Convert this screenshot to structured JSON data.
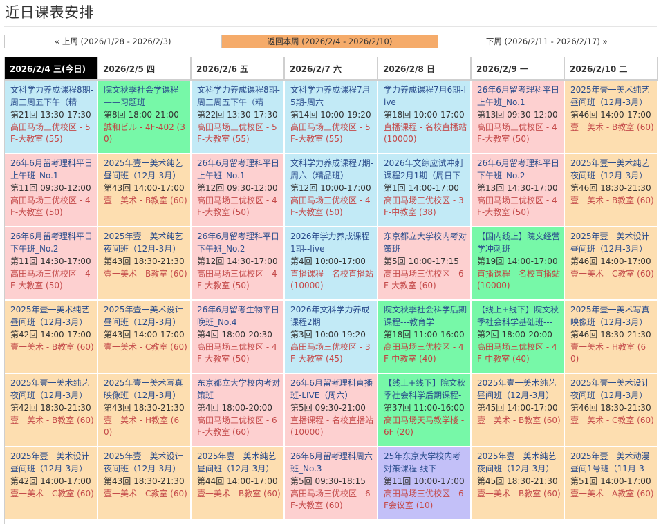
{
  "page": {
    "title": "近日课表安排"
  },
  "week_nav": {
    "prev": "« 上周 (2026/1/28 - 2026/2/3)",
    "current": "返回本周 (2026/2/4 - 2026/2/10)",
    "next": "下周 (2026/2/11 - 2026/2/17) »"
  },
  "colors": {
    "today_header_bg": "#000000",
    "current_week_bg": "#f5ab6a",
    "blue": "#c2eaf6",
    "green": "#77f8a8",
    "pink": "#fdd0d0",
    "peach": "#fddeb0",
    "purple": "#c3c0f8",
    "course_link": "#2a4c8c",
    "venue_text": "#c44a4a"
  },
  "days": [
    {
      "date": "2026/2/4 三(今日)",
      "today": true,
      "classes": [
        {
          "name": "文科学力养成课程8期-周三周五下午（精",
          "session": "第21回 13:30-17:30",
          "venue": "高田马场三优校区 - 5F-大教室 (55)",
          "color": "blue"
        },
        {
          "name": "26年6月留考理科平日上午班_No.1",
          "session": "第11回 09:30-12:00",
          "venue": "高田马场三优校区 - 4F-大教室 (50)",
          "color": "pink"
        },
        {
          "name": "26年6月留考理科平日下午班_No.2",
          "session": "第11回 14:30-17:00",
          "venue": "高田马场三优校区 - 4F-大教室 (50)",
          "color": "pink"
        },
        {
          "name": "2025年壹一美术纯艺昼间班（12月-3月）",
          "session": "第42回 14:00-17:00",
          "venue": "壹一美术 - B教室 (60)",
          "color": "peach"
        },
        {
          "name": "2025年壹一美术纯艺夜间班（12月-3月）",
          "session": "第42回 18:30-21:30",
          "venue": "壹一美术 - B教室 (60)",
          "color": "peach"
        },
        {
          "name": "2025年壹一美术设计昼间班（12月-3月）",
          "session": "第42回 14:00-17:00",
          "venue": "壹一美术 - C教室 (60)",
          "color": "peach"
        }
      ]
    },
    {
      "date": "2026/2/5 四",
      "today": false,
      "classes": [
        {
          "name": "院文秋季社会学课程——习题班",
          "session": "第8回 18:00-21:00",
          "venue": "誠和ビル - 4F-402 (30)",
          "color": "green"
        },
        {
          "name": "2025年壹一美术纯艺昼间班（12月-3月）",
          "session": "第43回 14:00-17:00",
          "venue": "壹一美术 - B教室 (60)",
          "color": "peach"
        },
        {
          "name": "2025年壹一美术纯艺夜间班（12月-3月）",
          "session": "第43回 18:30-21:30",
          "venue": "壹一美术 - B教室 (60)",
          "color": "peach"
        },
        {
          "name": "2025年壹一美术设计昼间班（12月-3月）",
          "session": "第43回 14:00-17:00",
          "venue": "壹一美术 - C教室 (60)",
          "color": "peach"
        },
        {
          "name": "2025年壹一美术写真映像班（12月-3月）",
          "session": "第43回 18:30-21:30",
          "venue": "壹一美术 - H教室 (60)",
          "color": "peach"
        },
        {
          "name": "2025年壹一美术设计夜间班（12月-3月）",
          "session": "第43回 18:30-21:30",
          "venue": "壹一美术 - C教室 (60)",
          "color": "peach"
        }
      ]
    },
    {
      "date": "2026/2/6 五",
      "today": false,
      "classes": [
        {
          "name": "文科学力养成课程8期-周三周五下午（精",
          "session": "第22回 13:30-17:30",
          "venue": "高田马场三优校区 - 5F-大教室 (55)",
          "color": "blue"
        },
        {
          "name": "26年6月留考理科平日上午班_No.1",
          "session": "第12回 09:30-12:00",
          "venue": "高田马场三优校区 - 4F-大教室 (50)",
          "color": "pink"
        },
        {
          "name": "26年6月留考理科平日下午班_No.2",
          "session": "第12回 14:30-17:00",
          "venue": "高田马场三优校区 - 4F-大教室 (50)",
          "color": "pink"
        },
        {
          "name": "26年6月留考生物平日晚班_No.4",
          "session": "第4回 18:00-20:30",
          "venue": "高田马场三优校区 - 4F-大教室 (50)",
          "color": "pink"
        },
        {
          "name": "东京都立大学校内考对策班",
          "session": "第4回 18:00-20:00",
          "venue": "高田马场三优校区 - 6F-大教室 (60)",
          "color": "pink"
        },
        {
          "name": "2025年壹一美术纯艺昼间班（12月-3月）",
          "session": "第44回 14:00-17:00",
          "venue": "壹一美术 - B教室 (60)",
          "color": "peach"
        }
      ]
    },
    {
      "date": "2026/2/7 六",
      "today": false,
      "classes": [
        {
          "name": "文科学力养成课程7月5期-周六",
          "session": "第14回 10:00-19:20",
          "venue": "高田马场三优校区 - 5F-大教室 (55)",
          "color": "blue"
        },
        {
          "name": "文科学力养成课程7期-周六（精品班）",
          "session": "第12回 10:00-17:00",
          "venue": "高田马场三优校区 - 4F-大教室 (50)",
          "color": "blue"
        },
        {
          "name": "2026年学力养成课程1期--live",
          "session": "第4回 10:00-17:00",
          "venue": "直播课程 - 名校直播站 (10000)",
          "color": "blue"
        },
        {
          "name": "2026年文科学力养成课程2期",
          "session": "第3回 10:00-19:20",
          "venue": "高田马场三优校区 - 3F-大教室 (45)",
          "color": "blue"
        },
        {
          "name": "26年6月留考理科直播班-LIVE（周六）",
          "session": "第5回 09:30-21:00",
          "venue": "直播课程 - 名校直播站 (10000)",
          "color": "pink"
        },
        {
          "name": "26年6月留考理科周六班_No.3",
          "session": "第5回 09:30-18:15",
          "venue": "高田马场三优校区 - 6F-大教室 (60)",
          "color": "pink"
        }
      ]
    },
    {
      "date": "2026/2/8 日",
      "today": false,
      "classes": [
        {
          "name": "学力养成课程7月6期-live",
          "session": "第18回 10:00-17:00",
          "venue": "直播课程 - 名校直播站 (10000)",
          "color": "blue"
        },
        {
          "name": "2026年文综应试冲刺课程2月1期（周日下",
          "session": "第1回 14:00-17:00",
          "venue": "高田马场三优校区 - 3F-中教室 (38)",
          "color": "blue"
        },
        {
          "name": "东京都立大学校内考对策班",
          "session": "第5回 10:00-17:15",
          "venue": "高田马场三优校区 - 6F-大教室 (60)",
          "color": "pink"
        },
        {
          "name": "院文秋季社会科学后期课程---教育学",
          "session": "第18回 11:00-16:00",
          "venue": "高田马场三优校区 - 4F-中教室 (40)",
          "color": "green"
        },
        {
          "name": "【线上+线下】院文秋季社会科学后期课程-",
          "session": "第37回 11:00-16:00",
          "venue": "高田马场天马教学楼 - 6F (20)",
          "color": "green"
        },
        {
          "name": "25年东京大学校内考对策课程-线下",
          "session": "第11回 10:00-17:00",
          "venue": "高田马场三优校区 - 6F会议室 (10)",
          "color": "purple"
        }
      ]
    },
    {
      "date": "2026/2/9 一",
      "today": false,
      "classes": [
        {
          "name": "26年6月留考理科平日上午班_No.1",
          "session": "第13回 09:30-12:00",
          "venue": "高田马场三优校区 - 4F-大教室 (50)",
          "color": "pink"
        },
        {
          "name": "26年6月留考理科平日下午班_No.2",
          "session": "第13回 14:30-17:00",
          "venue": "高田马场三优校区 - 4F-大教室 (50)",
          "color": "pink"
        },
        {
          "name": "【国内线上】院文经营学冲刺班",
          "session": "第19回 14:00-17:00",
          "venue": "直播课程 - 名校直播站 (10000)",
          "color": "green"
        },
        {
          "name": "【线上+线下】院文秋季社会科学基础班---",
          "session": "第2回 18:00-20:00",
          "venue": "高田马场三优校区 - 4F-中教室 (40)",
          "color": "green"
        },
        {
          "name": "2025年壹一美术纯艺昼间班（12月-3月）",
          "session": "第45回 14:00-17:00",
          "venue": "壹一美术 - B教室 (60)",
          "color": "peach"
        },
        {
          "name": "2025年壹一美术纯艺夜间班（12月-3月）",
          "session": "第45回 18:30-21:30",
          "venue": "壹一美术 - B教室 (60)",
          "color": "peach"
        }
      ]
    },
    {
      "date": "2026/2/10 二",
      "today": false,
      "classes": [
        {
          "name": "2025年壹一美术纯艺昼间班（12月-3月）",
          "session": "第46回 14:00-17:00",
          "venue": "壹一美术 - B教室 (60)",
          "color": "peach"
        },
        {
          "name": "2025年壹一美术纯艺夜间班（12月-3月）",
          "session": "第46回 18:30-21:30",
          "venue": "壹一美术 - B教室 (60)",
          "color": "peach"
        },
        {
          "name": "2025年壹一美术设计昼间班（12月-3月）",
          "session": "第46回 14:00-17:00",
          "venue": "壹一美术 - C教室 (60)",
          "color": "peach"
        },
        {
          "name": "2025年壹一美术写真映像班（12月-3月）",
          "session": "第46回 18:30-21:30",
          "venue": "壹一美术 - H教室 (60)",
          "color": "peach"
        },
        {
          "name": "2025年壹一美术设计夜间班（12月-3月）",
          "session": "第46回 18:30-21:30",
          "venue": "壹一美术 - C教室 (60)",
          "color": "peach"
        },
        {
          "name": "2025年壹一美术动漫昼间1号班（11月-3",
          "session": "第51回 14:00-17:00",
          "venue": "壹一美术 - A教室 (60)",
          "color": "peach"
        }
      ]
    }
  ]
}
